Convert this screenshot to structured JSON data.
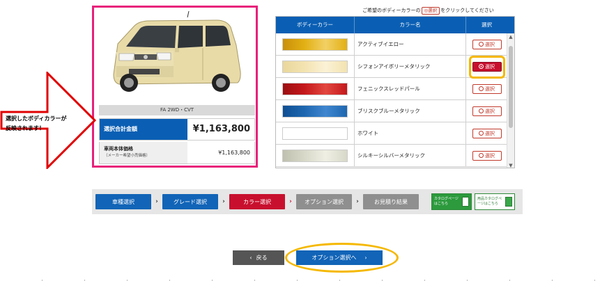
{
  "car": {
    "grade": "FA 2WD・CVT",
    "total_label": "選択合計金額",
    "total_price": "¥1,163,800",
    "base_label_1": "車両本体価格",
    "base_label_2": "（メーカー希望小売価格）",
    "base_price": "¥1,163,800",
    "body_color_hex": "#e9dcad"
  },
  "callout": {
    "line1": "選択したボディカラーが",
    "line2": "反映されます！"
  },
  "instruction": {
    "prefix": "ご希望のボディーカラーの",
    "chip": "◎選択",
    "suffix": "をクリックしてください"
  },
  "table": {
    "headers": [
      "ボディーカラー",
      "カラー名",
      "選択"
    ],
    "rows": [
      {
        "name": "アクティブイエロー",
        "swatch": "#e2b013",
        "button": "選択",
        "selected": false
      },
      {
        "name": "シフォンアイボリーメタリック",
        "swatch": "#f3e3b0",
        "button": "選択",
        "selected": true
      },
      {
        "name": "フェニックスレッドパール",
        "swatch": "#c4181c",
        "button": "選択",
        "selected": false
      },
      {
        "name": "ブリスクブルーメタリック",
        "swatch": "#1e67b0",
        "button": "選択",
        "selected": false
      },
      {
        "name": "ホワイト",
        "swatch": "#ffffff",
        "button": "選択",
        "selected": false
      },
      {
        "name": "シルキーシルバーメタリック",
        "swatch": "#d7d8c8",
        "button": "選択",
        "selected": false
      }
    ]
  },
  "steps": {
    "items": [
      {
        "label": "車種選択",
        "state": "done"
      },
      {
        "label": "グレード選択",
        "state": "done"
      },
      {
        "label": "カラー選択",
        "state": "current"
      },
      {
        "label": "オプション選択",
        "state": "todo"
      },
      {
        "label": "お見積り結果",
        "state": "todo"
      }
    ],
    "catalog_1": "カタログページはこちら",
    "catalog_2": "用品カタログページはこちら"
  },
  "nav": {
    "back": "戻る",
    "next": "オプション選択へ"
  },
  "colors": {
    "accent_blue": "#1164b7",
    "accent_red": "#c8102e",
    "highlight_yellow": "#f5b800",
    "panel_border_pink": "#e8207a"
  }
}
